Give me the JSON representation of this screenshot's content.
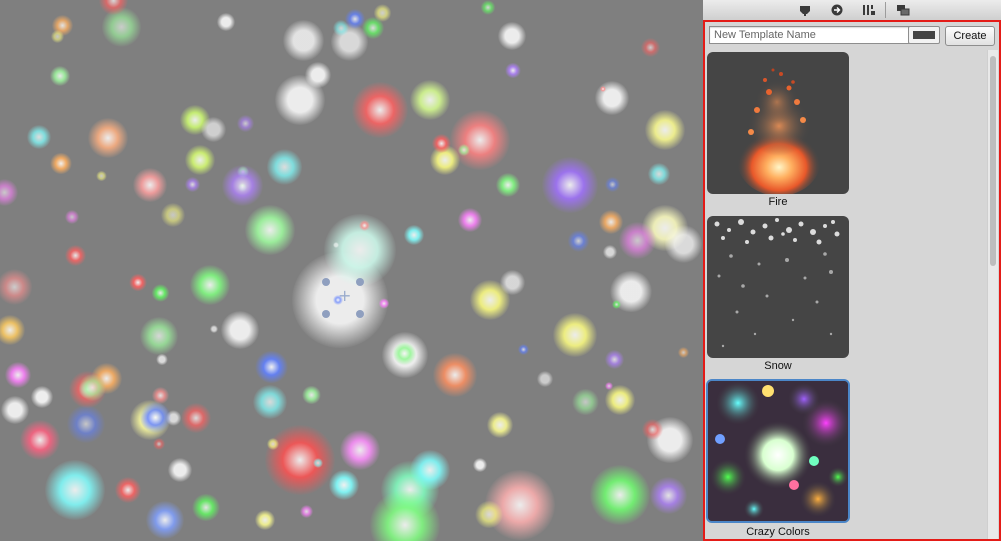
{
  "toolbar": {
    "icons": [
      "transform-tool-icon",
      "navigate-icon",
      "layout-icon",
      "windows-icon"
    ]
  },
  "templates_panel": {
    "name_input": {
      "placeholder": "New Template Name",
      "value": ""
    },
    "color_swatch": {
      "color": "#444444"
    },
    "create_label": "Create",
    "templates": [
      {
        "label": "Fire",
        "selected": false
      },
      {
        "label": "Snow",
        "selected": false
      },
      {
        "label": "Crazy Colors",
        "selected": true
      }
    ]
  },
  "colors": {
    "highlight_border": "#e41b17",
    "selection_border": "#4b86c8",
    "viewport_background": "#7f7f7f"
  }
}
